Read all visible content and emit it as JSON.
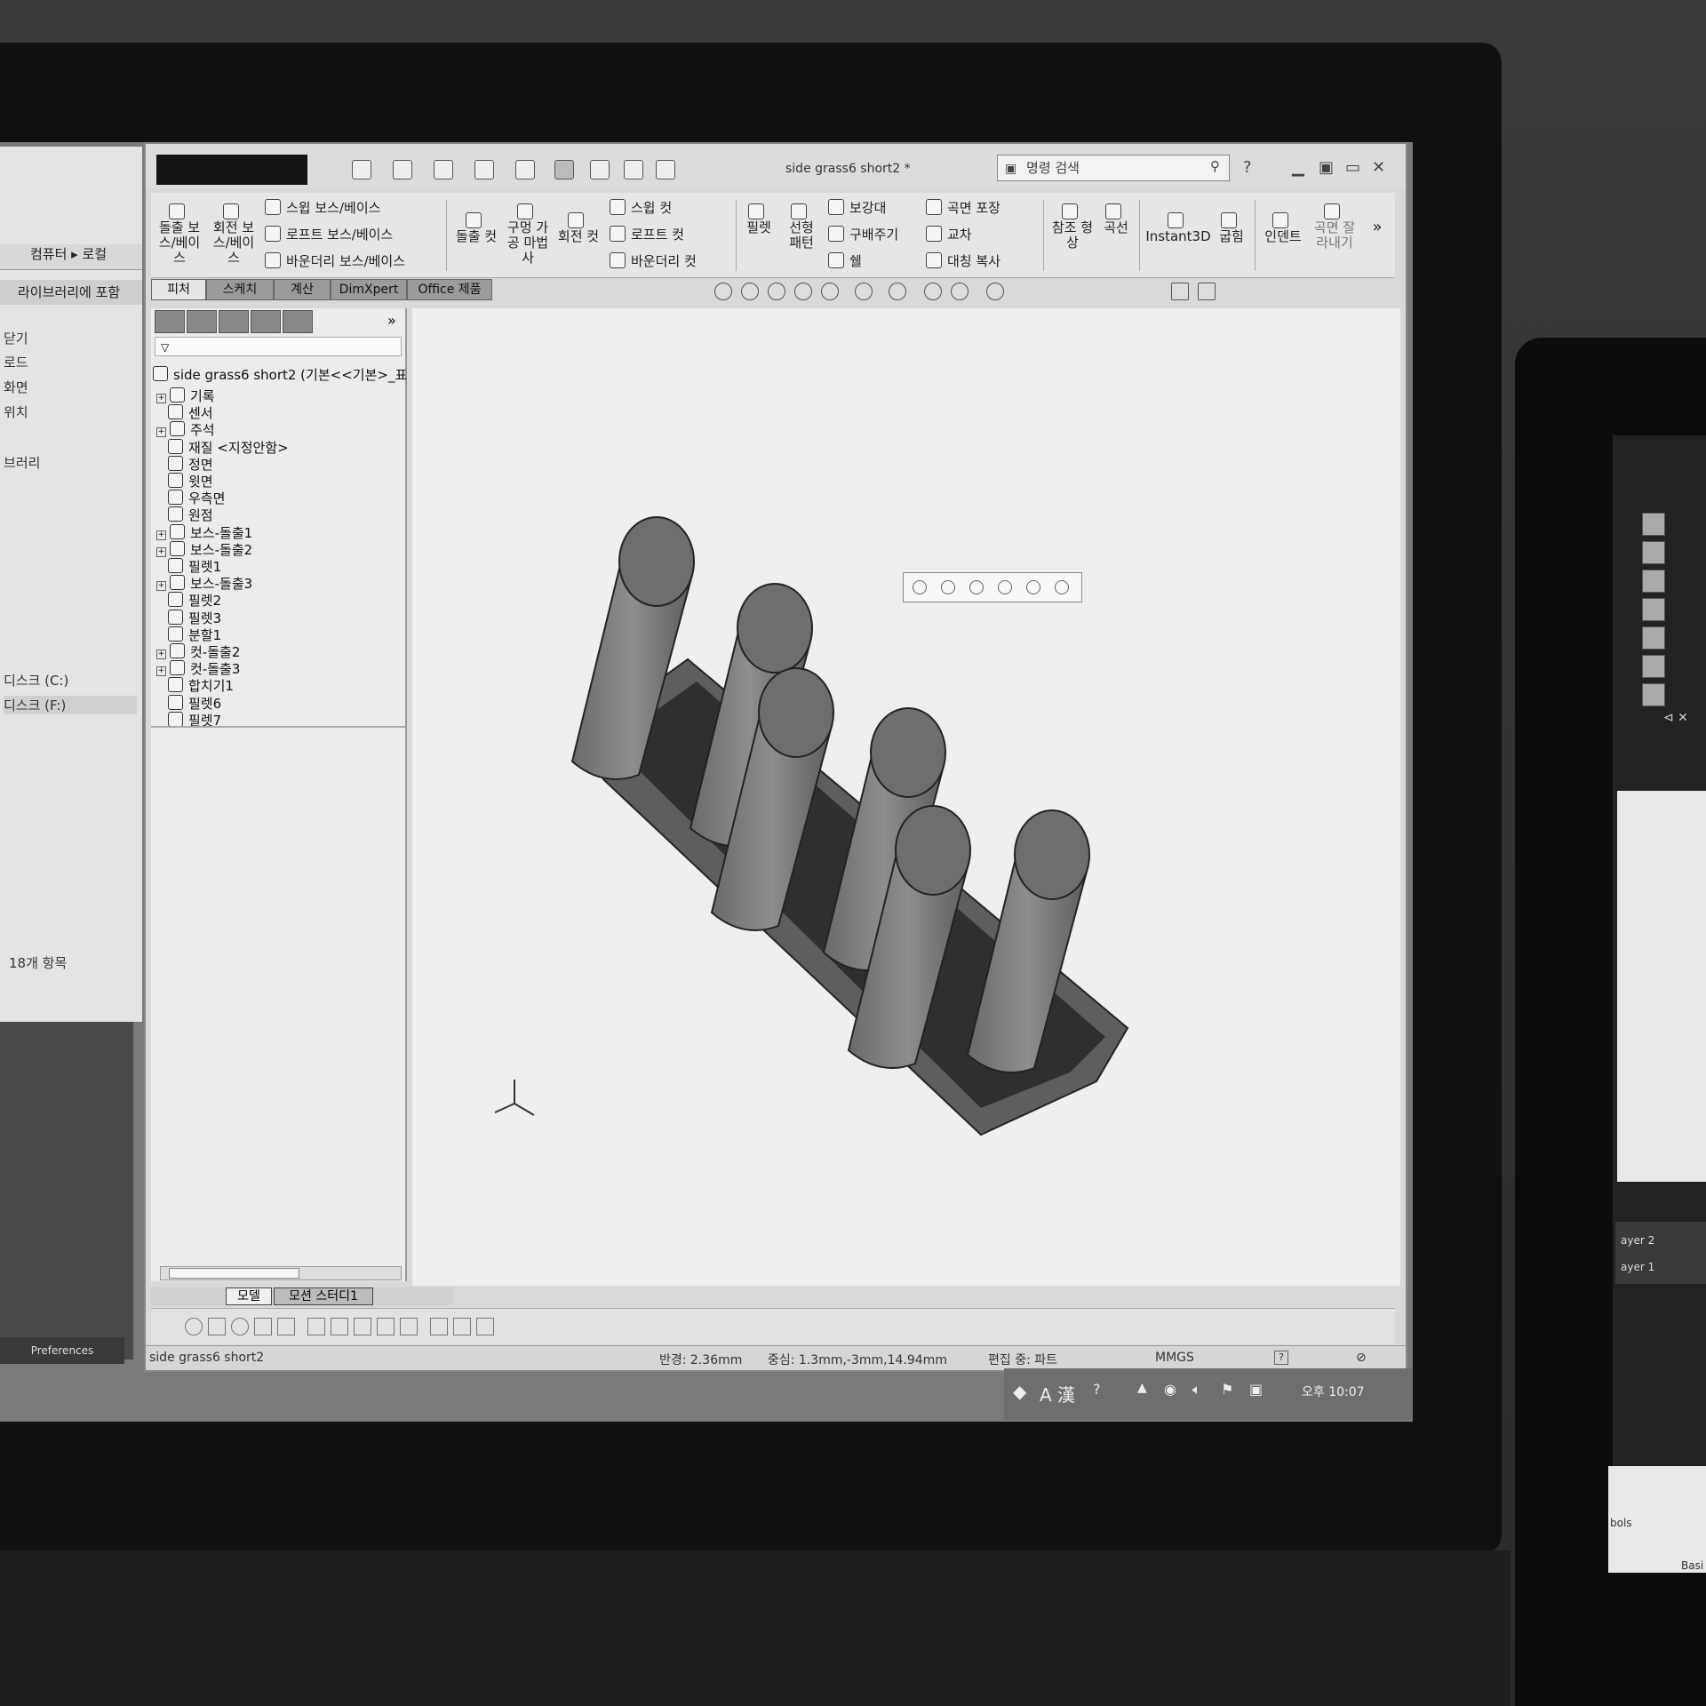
{
  "explorer": {
    "breadcrumb": "컴퓨터 ▸ 로컬",
    "library_button": "라이브러리에 포함",
    "nav_items": [
      "닫기",
      "로드",
      "화면",
      "위치",
      "브러리",
      "디스크 (C:)",
      "디스크 (F:)"
    ],
    "item_count": "18개 항목",
    "preferences": "Preferences"
  },
  "window": {
    "title": "side grass6 short2 *",
    "search_placeholder": "명령 검색"
  },
  "ribbon": {
    "big_buttons": [
      {
        "id": "extrude-boss",
        "label": "돌출 보스/베이스"
      },
      {
        "id": "revolve-boss",
        "label": "회전 보스/베이스"
      },
      {
        "id": "extrude-cut",
        "label": "돌출 컷"
      },
      {
        "id": "hole-wizard",
        "label": "구멍 가공 마법사"
      },
      {
        "id": "revolve-cut",
        "label": "회전 컷"
      },
      {
        "id": "fillet",
        "label": "필렛"
      },
      {
        "id": "linear-pattern",
        "label": "선형 패턴"
      },
      {
        "id": "reference-geometry",
        "label": "참조 형상"
      },
      {
        "id": "curves",
        "label": "곡선"
      },
      {
        "id": "instant3d",
        "label": "Instant3D"
      },
      {
        "id": "flex",
        "label": "굽힘"
      },
      {
        "id": "indent",
        "label": "인덴트"
      },
      {
        "id": "split-surface",
        "label": "곡면 잘라내기"
      }
    ],
    "small_buttons": {
      "sweep_boss": "스윕 보스/베이스",
      "loft_boss": "로프트 보스/베이스",
      "boundary_boss": "바운더리 보스/베이스",
      "sweep_cut": "스윕 컷",
      "loft_cut": "로프트 컷",
      "boundary_cut": "바운더리 컷",
      "rib": "보강대",
      "draft": "구배주기",
      "shell": "쉘",
      "wrap": "곡면 포장",
      "intersect": "교차",
      "mirror": "대칭 복사"
    }
  },
  "tabs": [
    "피처",
    "스케치",
    "계산",
    "DimXpert",
    "Office 제품"
  ],
  "active_tab": "피처",
  "tree": {
    "root": "side grass6 short2  (기본<<기본>_표",
    "nodes": [
      {
        "label": "기록",
        "expandable": true
      },
      {
        "label": "센서",
        "expandable": false
      },
      {
        "label": "주석",
        "expandable": true
      },
      {
        "label": "재질 <지정안함>",
        "expandable": false
      },
      {
        "label": "정면",
        "expandable": false
      },
      {
        "label": "윗면",
        "expandable": false
      },
      {
        "label": "우측면",
        "expandable": false
      },
      {
        "label": "원점",
        "expandable": false
      },
      {
        "label": "보스-돌출1",
        "expandable": true
      },
      {
        "label": "보스-돌출2",
        "expandable": true
      },
      {
        "label": "필렛1",
        "expandable": false
      },
      {
        "label": "보스-돌출3",
        "expandable": true
      },
      {
        "label": "필렛2",
        "expandable": false
      },
      {
        "label": "필렛3",
        "expandable": false
      },
      {
        "label": "분할1",
        "expandable": false
      },
      {
        "label": "컷-돌출2",
        "expandable": true
      },
      {
        "label": "컷-돌출3",
        "expandable": true
      },
      {
        "label": "합치기1",
        "expandable": false
      },
      {
        "label": "필렛6",
        "expandable": false
      },
      {
        "label": "필렛7",
        "expandable": false
      }
    ]
  },
  "bottom_tabs": [
    "모델",
    "모션 스터디1"
  ],
  "status": {
    "filename": "side grass6 short2",
    "radius": "반경: 2.36mm",
    "center": "중심: 1.3mm,-3mm,14.94mm",
    "mode": "편집 중: 파트",
    "units": "MMGS"
  },
  "taskbar": {
    "ime": "A 漢",
    "time": "오후 10:07"
  },
  "right_monitor": {
    "layers": [
      "ayer 2",
      "ayer 1"
    ],
    "symbols": "bols",
    "basic": "Basi"
  }
}
